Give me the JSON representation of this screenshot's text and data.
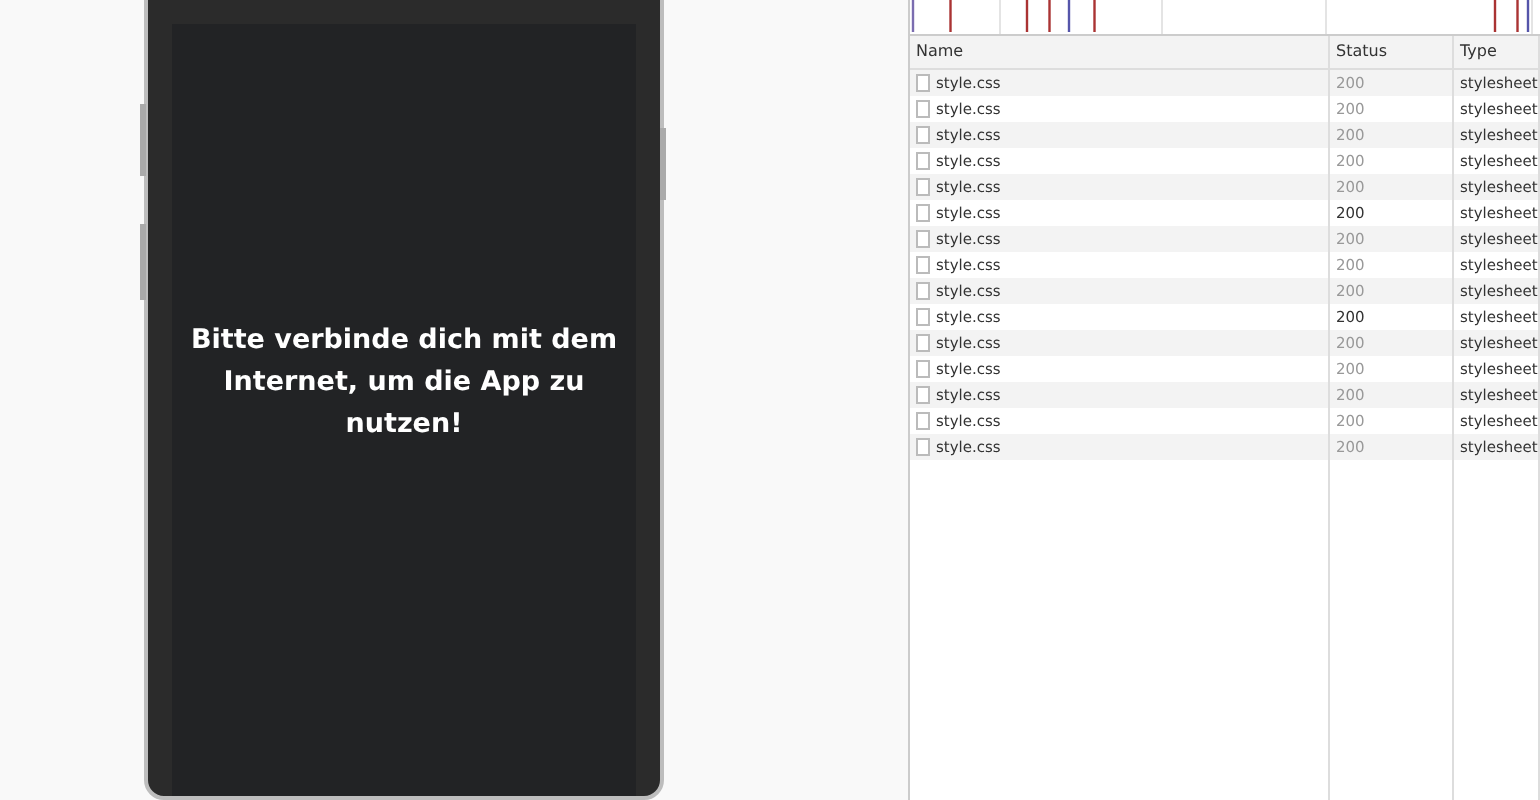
{
  "phone": {
    "message": "Bitte verbinde dich mit dem Internet, um die App zu nutzen!"
  },
  "network": {
    "columns": [
      "Name",
      "Status",
      "Type"
    ],
    "rows": [
      {
        "name": "style.css",
        "status": "200",
        "type": "stylesheet",
        "dimmed": true
      },
      {
        "name": "style.css",
        "status": "200",
        "type": "stylesheet",
        "dimmed": true
      },
      {
        "name": "style.css",
        "status": "200",
        "type": "stylesheet",
        "dimmed": true
      },
      {
        "name": "style.css",
        "status": "200",
        "type": "stylesheet",
        "dimmed": true
      },
      {
        "name": "style.css",
        "status": "200",
        "type": "stylesheet",
        "dimmed": true
      },
      {
        "name": "style.css",
        "status": "200",
        "type": "stylesheet",
        "dimmed": false
      },
      {
        "name": "style.css",
        "status": "200",
        "type": "stylesheet",
        "dimmed": true
      },
      {
        "name": "style.css",
        "status": "200",
        "type": "stylesheet",
        "dimmed": true
      },
      {
        "name": "style.css",
        "status": "200",
        "type": "stylesheet",
        "dimmed": true
      },
      {
        "name": "style.css",
        "status": "200",
        "type": "stylesheet",
        "dimmed": false
      },
      {
        "name": "style.css",
        "status": "200",
        "type": "stylesheet",
        "dimmed": true
      },
      {
        "name": "style.css",
        "status": "200",
        "type": "stylesheet",
        "dimmed": true
      },
      {
        "name": "style.css",
        "status": "200",
        "type": "stylesheet",
        "dimmed": true
      },
      {
        "name": "style.css",
        "status": "200",
        "type": "stylesheet",
        "dimmed": true
      },
      {
        "name": "style.css",
        "status": "200",
        "type": "stylesheet",
        "dimmed": true
      }
    ]
  }
}
